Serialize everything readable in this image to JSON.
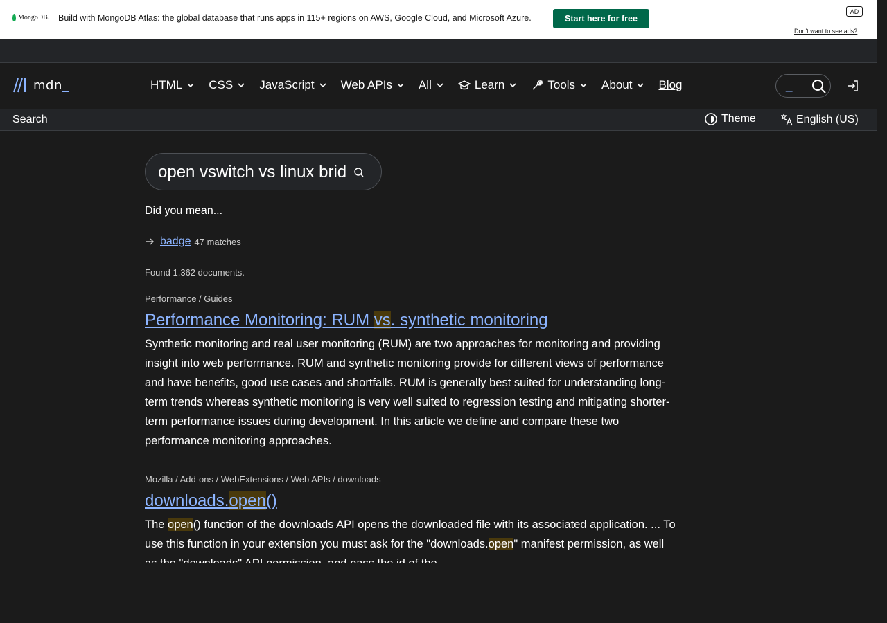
{
  "ad": {
    "logo_text": "MongoDB.",
    "text": "Build with MongoDB Atlas: the global database that runs apps in 115+ regions on AWS, Google Cloud, and Microsoft Azure.",
    "cta": "Start here for free",
    "badge": "AD",
    "optout": "Don't want to see ads?"
  },
  "logo": {
    "text": "mdn",
    "suffix": "_"
  },
  "nav": {
    "items": [
      "HTML",
      "CSS",
      "JavaScript",
      "Web APIs",
      "All",
      "Learn",
      "Tools",
      "About"
    ],
    "blog": "Blog",
    "search_cursor": "_"
  },
  "subbar": {
    "breadcrumb": "Search",
    "theme": "Theme",
    "language": "English (US)"
  },
  "search": {
    "value": "open vswitch vs linux bridge"
  },
  "suggestions": {
    "heading": "Did you mean...",
    "term": "badge",
    "count": "47 matches"
  },
  "found": "Found 1,362 documents.",
  "results": [
    {
      "path": "Performance / Guides",
      "title_parts": [
        "Performance Monitoring: RUM ",
        "vs",
        ". synthetic monitoring"
      ],
      "snippet": "Synthetic monitoring and real user monitoring (RUM) are two approaches for monitoring and providing insight into web performance. RUM and synthetic monitoring provide for different views of performance and have benefits, good use cases and shortfalls. RUM is generally best suited for understanding long-term trends whereas synthetic monitoring is very well suited to regression testing and mitigating shorter-term performance issues during development. In this article we define and compare these two performance monitoring approaches."
    },
    {
      "path": "Mozilla / Add-ons / WebExtensions / Web APIs / downloads",
      "title_parts": [
        "downloads.",
        "open",
        "()"
      ],
      "snippet_parts": [
        "The ",
        "open",
        "() function of the downloads API opens the downloaded file with its associated application. ... To use this function in your extension you must ask for the \"downloads.",
        "open",
        "\" manifest permission, as well as the \"downloads\" API permission, and pass the id of the"
      ]
    }
  ],
  "colors": {
    "background": "#1b1b1b",
    "link": "#8cb4ff",
    "highlight": "#4a3a0c",
    "ad_cta": "#00684a"
  }
}
